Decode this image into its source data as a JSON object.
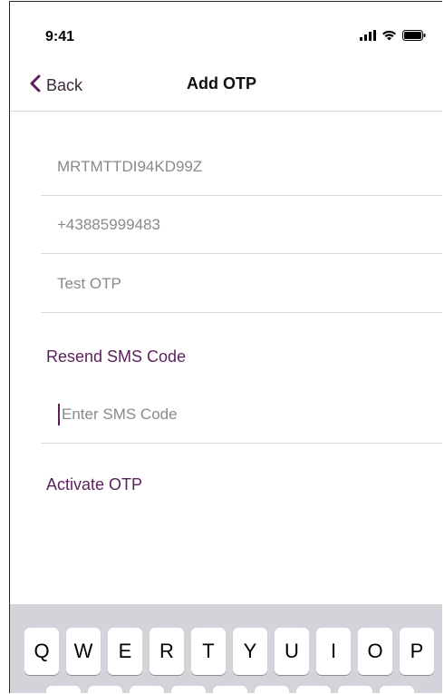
{
  "status_bar": {
    "time": "9:41",
    "icons": [
      "signal-icon",
      "wifi-icon",
      "battery-icon"
    ]
  },
  "nav": {
    "back_label": "Back",
    "title": "Add OTP"
  },
  "form": {
    "secret_key": {
      "value": "MRTMTTDI94KD99Z"
    },
    "phone_number": {
      "value": "+43885999483"
    },
    "otp_name": {
      "value": "Test OTP"
    },
    "resend_label": "Resend SMS Code",
    "sms_code": {
      "value": "",
      "placeholder": "Enter SMS Code"
    },
    "activate_label": "Activate OTP"
  },
  "keyboard": {
    "row1": [
      "Q",
      "W",
      "E",
      "R",
      "T",
      "Y",
      "U",
      "I",
      "O",
      "P"
    ]
  },
  "colors": {
    "accent": "#5b1f5b",
    "placeholder": "#8a8a8a",
    "keyboard_bg": "#d2d4da"
  }
}
